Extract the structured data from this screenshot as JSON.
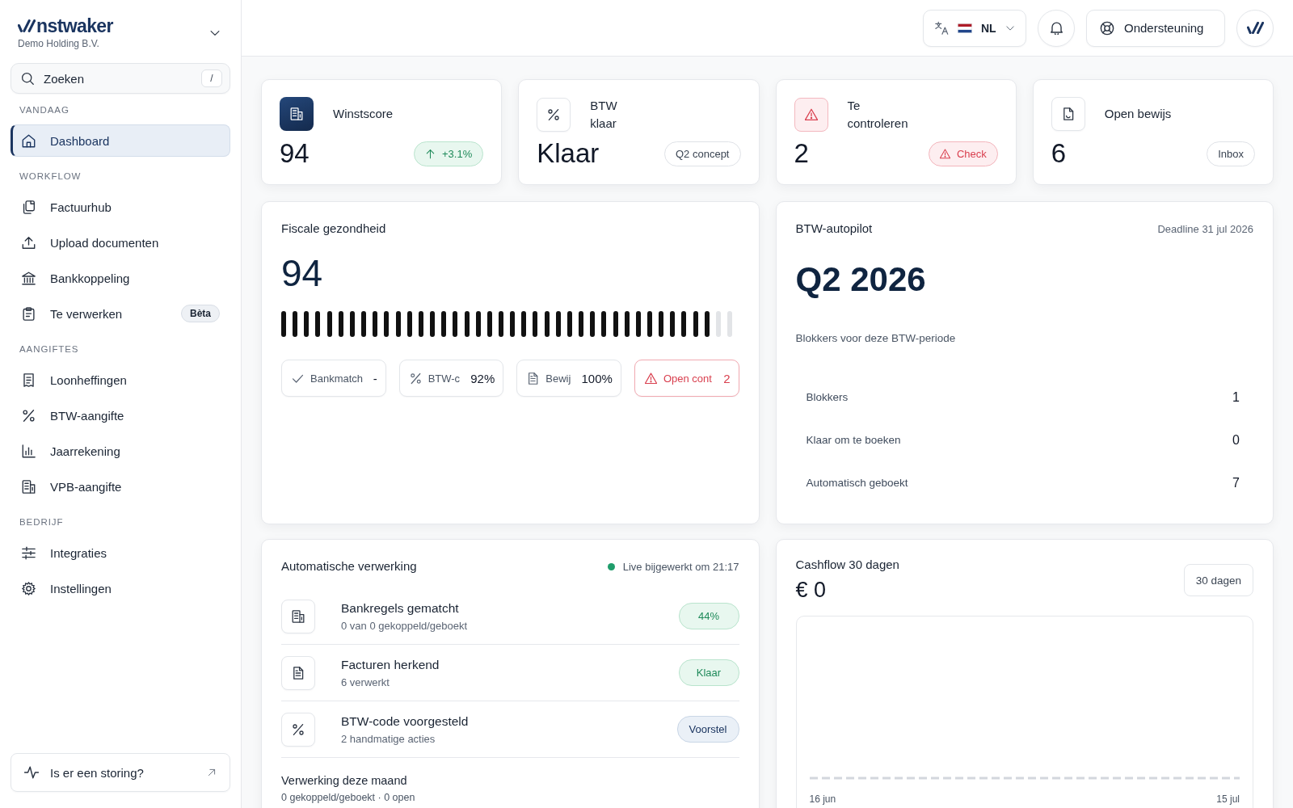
{
  "sidebar": {
    "brand": {
      "name": "nstwaker",
      "company": "Demo Holding B.V."
    },
    "search": {
      "placeholder": "Zoeken",
      "shortcut": "/"
    },
    "sections": [
      {
        "label": "VANDAAG",
        "items": [
          {
            "label": "Dashboard",
            "selected": true
          }
        ]
      },
      {
        "label": "WORKFLOW",
        "items": [
          {
            "label": "Factuurhub",
            "selected": false
          },
          {
            "label": "Upload documenten",
            "selected": false
          },
          {
            "label": "Bankkoppeling",
            "selected": false
          },
          {
            "label": "Te verwerken",
            "selected": false,
            "badge": "Bèta"
          }
        ]
      },
      {
        "label": "AANGIFTES",
        "items": [
          {
            "label": "Loonheffingen",
            "selected": false
          },
          {
            "label": "BTW-aangifte",
            "selected": false
          },
          {
            "label": "Jaarrekening",
            "selected": false
          },
          {
            "label": "VPB-aangifte",
            "selected": false
          }
        ]
      },
      {
        "label": "BEDRIJF",
        "items": [
          {
            "label": "Integraties",
            "selected": false
          },
          {
            "label": "Instellingen",
            "selected": false
          }
        ]
      }
    ],
    "status_link": "Is er een storing?"
  },
  "topbar": {
    "language": "NL",
    "support": "Ondersteuning"
  },
  "kpi_cards": [
    {
      "title_lines": [
        "Winstscore"
      ],
      "kind": "brand",
      "value": "94",
      "badge": {
        "text": "+3.1%",
        "kind": "trend"
      }
    },
    {
      "title_lines": [
        "BTW",
        "klaar"
      ],
      "kind": "neutral",
      "value": "Klaar",
      "badge": {
        "text": "Q2 concept",
        "kind": "neutral"
      }
    },
    {
      "title_lines": [
        "Te",
        "controleren"
      ],
      "kind": "alert",
      "value": "2",
      "badge": {
        "text": "Check",
        "kind": "alert"
      }
    },
    {
      "title_lines": [
        "Open bewijs"
      ],
      "kind": "neutral",
      "value": "6",
      "badge": {
        "text": "Inbox",
        "kind": "neutral"
      }
    }
  ],
  "fiscal_health": {
    "title": "Fiscale gezondheid",
    "score": "94",
    "level": 0.94,
    "metrics": [
      {
        "label": "Bankmatch",
        "value": "-",
        "alert": false
      },
      {
        "label": "BTW-c",
        "value": "92%",
        "alert": false
      },
      {
        "label": "Bewij",
        "value": "100%",
        "alert": false
      },
      {
        "label": "Open cont",
        "value": "2",
        "alert": true
      }
    ]
  },
  "vat_autopilot": {
    "title": "BTW-autopilot",
    "deadline": "Deadline 31 jul 2026",
    "period": "Q2 2026",
    "subtitle": "Blokkers voor deze BTW-periode",
    "stats": [
      {
        "label": "Blokkers",
        "value": "1"
      },
      {
        "label": "Klaar om te boeken",
        "value": "0"
      },
      {
        "label": "Automatisch geboekt",
        "value": "7"
      }
    ]
  },
  "processing": {
    "title": "Automatische verwerking",
    "live": true,
    "live_text": "Live bijgewerkt om 21:17",
    "rows": [
      {
        "title": "Bankregels gematcht",
        "subtitle": "0 van 0 gekoppeld/geboekt",
        "badge": {
          "text": "44%",
          "kind": "success"
        }
      },
      {
        "title": "Facturen herkend",
        "subtitle": "6 verwerkt",
        "badge": {
          "text": "Klaar",
          "kind": "success"
        }
      },
      {
        "title": "BTW-code voorgesteld",
        "subtitle": "2 handmatige acties",
        "badge": {
          "text": "Voorstel",
          "kind": "info"
        }
      }
    ],
    "summary": {
      "title": "Verwerking deze maand",
      "text": "0 gekoppeld/geboekt · 0 open"
    }
  },
  "cashflow": {
    "title": "Cashflow 30 dagen",
    "value": "€ 0",
    "period_button": "30 dagen",
    "x_labels": [
      "16 jun",
      "15 jul"
    ]
  }
}
